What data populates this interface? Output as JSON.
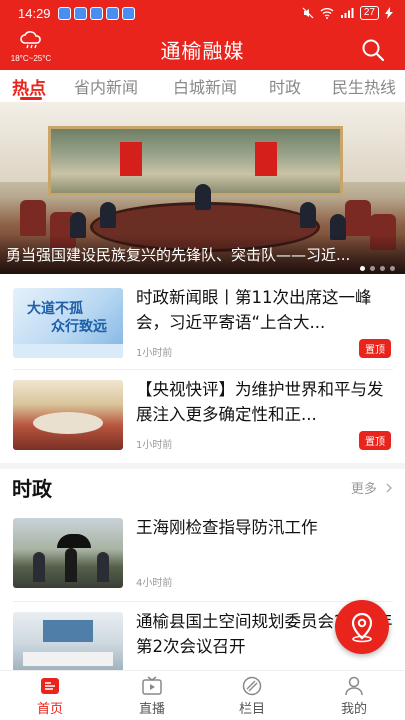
{
  "status": {
    "time": "14:29",
    "battery": "27"
  },
  "header": {
    "title": "通榆融媒",
    "weather_temp": "18°C~25°C"
  },
  "tabs": [
    "热点",
    "省内新闻",
    "白城新闻",
    "时政",
    "民生热线"
  ],
  "hero": {
    "caption": "勇当强国建设民族复兴的先锋队、突击队——习近..."
  },
  "news": [
    {
      "title": "时政新闻眼丨第11次出席这一峰会，习近平寄语“上合大...",
      "time": "1小时前",
      "pin": "置顶",
      "thumb_text": [
        "大道不孤",
        "众行致远"
      ]
    },
    {
      "title": "【央视快评】为维护世界和平与发展注入更多确定性和正...",
      "time": "1小时前",
      "pin": "置顶"
    }
  ],
  "section": {
    "title": "时政",
    "more": "更多"
  },
  "section_news": [
    {
      "title": "王海刚检查指导防汛工作",
      "time": "4小时前"
    },
    {
      "title": "通榆县国土空间规划委员会2023年第2次会议召开",
      "time": ""
    }
  ],
  "bottom_nav": [
    "首页",
    "直播",
    "栏目",
    "我的"
  ],
  "colors": {
    "brand": "#e8241c"
  }
}
